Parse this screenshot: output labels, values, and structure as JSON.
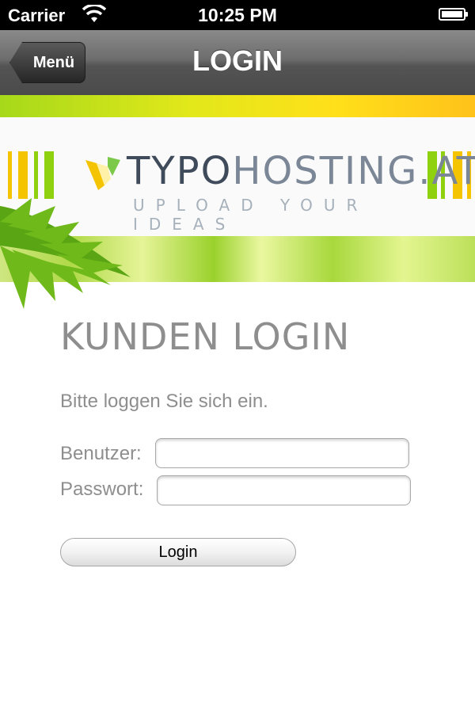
{
  "status_bar": {
    "carrier": "Carrier",
    "time": "10:25 PM",
    "wifi_icon": "wifi-icon",
    "battery_icon": "battery-icon"
  },
  "nav": {
    "back_label": "Menü",
    "title": "LOGIN"
  },
  "banner": {
    "logo_part1": "TYPO",
    "logo_part2": "HOSTING.AT",
    "tagline": "UPLOAD YOUR IDEAS",
    "colors": {
      "green": "#8fd00f",
      "yellow": "#f5c400",
      "dark_text": "#3f4a5b"
    }
  },
  "form": {
    "heading": "KUNDEN LOGIN",
    "intro": "Bitte loggen Sie sich ein.",
    "user_label": "Benutzer:",
    "user_value": "",
    "password_label": "Passwort:",
    "password_value": "",
    "submit_label": "Login"
  }
}
